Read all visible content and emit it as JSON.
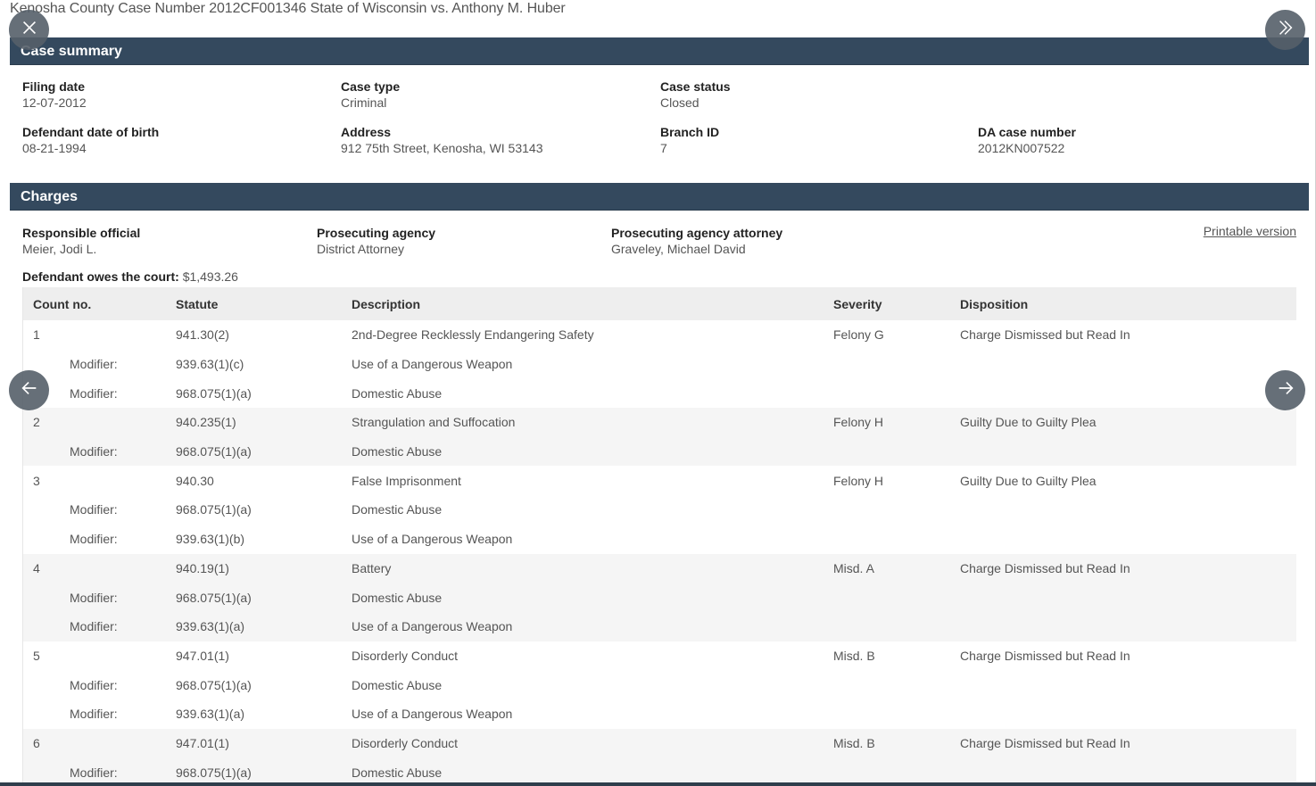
{
  "page": {
    "title": "Kenosha County Case Number 2012CF001346 State of Wisconsin vs. Anthony M. Huber"
  },
  "summary": {
    "heading": "Case summary",
    "fields": [
      {
        "label": "Filing date",
        "value": "12-07-2012"
      },
      {
        "label": "Case type",
        "value": "Criminal"
      },
      {
        "label": "Case status",
        "value": "Closed"
      },
      {
        "label": "Defendant date of birth",
        "value": "08-21-1994"
      },
      {
        "label": "Address",
        "value": "912 75th Street, Kenosha, WI 53143"
      },
      {
        "label": "Branch ID",
        "value": "7"
      },
      {
        "label": "DA case number",
        "value": "2012KN007522"
      }
    ]
  },
  "charges": {
    "heading": "Charges",
    "fields": [
      {
        "label": "Responsible official",
        "value": "Meier, Jodi L."
      },
      {
        "label": "Prosecuting agency",
        "value": "District Attorney"
      },
      {
        "label": "Prosecuting agency attorney",
        "value": "Graveley, Michael David"
      }
    ],
    "printable_label": "Printable version",
    "owes_label": "Defendant owes the court:",
    "owes_value": "$1,493.26",
    "columns": [
      "Count no.",
      "Statute",
      "Description",
      "Severity",
      "Disposition"
    ],
    "rows": [
      {
        "count": "1",
        "modifier": "",
        "statute": "941.30(2)",
        "description": "2nd-Degree Recklessly Endangering Safety",
        "severity": "Felony G",
        "disposition": "Charge Dismissed but Read In",
        "group": "odd"
      },
      {
        "count": "",
        "modifier": "Modifier:",
        "statute": "939.63(1)(c)",
        "description": "Use of a Dangerous Weapon",
        "severity": "",
        "disposition": "",
        "group": "odd"
      },
      {
        "count": "",
        "modifier": "Modifier:",
        "statute": "968.075(1)(a)",
        "description": "Domestic Abuse",
        "severity": "",
        "disposition": "",
        "group": "odd"
      },
      {
        "count": "2",
        "modifier": "",
        "statute": "940.235(1)",
        "description": "Strangulation and Suffocation",
        "severity": "Felony H",
        "disposition": "Guilty Due to Guilty Plea",
        "group": "even"
      },
      {
        "count": "",
        "modifier": "Modifier:",
        "statute": "968.075(1)(a)",
        "description": "Domestic Abuse",
        "severity": "",
        "disposition": "",
        "group": "even"
      },
      {
        "count": "3",
        "modifier": "",
        "statute": "940.30",
        "description": "False Imprisonment",
        "severity": "Felony H",
        "disposition": "Guilty Due to Guilty Plea",
        "group": "odd"
      },
      {
        "count": "",
        "modifier": "Modifier:",
        "statute": "968.075(1)(a)",
        "description": "Domestic Abuse",
        "severity": "",
        "disposition": "",
        "group": "odd"
      },
      {
        "count": "",
        "modifier": "Modifier:",
        "statute": "939.63(1)(b)",
        "description": "Use of a Dangerous Weapon",
        "severity": "",
        "disposition": "",
        "group": "odd"
      },
      {
        "count": "4",
        "modifier": "",
        "statute": "940.19(1)",
        "description": "Battery",
        "severity": "Misd. A",
        "disposition": "Charge Dismissed but Read In",
        "group": "even"
      },
      {
        "count": "",
        "modifier": "Modifier:",
        "statute": "968.075(1)(a)",
        "description": "Domestic Abuse",
        "severity": "",
        "disposition": "",
        "group": "even"
      },
      {
        "count": "",
        "modifier": "Modifier:",
        "statute": "939.63(1)(a)",
        "description": "Use of a Dangerous Weapon",
        "severity": "",
        "disposition": "",
        "group": "even"
      },
      {
        "count": "5",
        "modifier": "",
        "statute": "947.01(1)",
        "description": "Disorderly Conduct",
        "severity": "Misd. B",
        "disposition": "Charge Dismissed but Read In",
        "group": "odd"
      },
      {
        "count": "",
        "modifier": "Modifier:",
        "statute": "968.075(1)(a)",
        "description": "Domestic Abuse",
        "severity": "",
        "disposition": "",
        "group": "odd"
      },
      {
        "count": "",
        "modifier": "Modifier:",
        "statute": "939.63(1)(a)",
        "description": "Use of a Dangerous Weapon",
        "severity": "",
        "disposition": "",
        "group": "odd"
      },
      {
        "count": "6",
        "modifier": "",
        "statute": "947.01(1)",
        "description": "Disorderly Conduct",
        "severity": "Misd. B",
        "disposition": "Charge Dismissed but Read In",
        "group": "even"
      },
      {
        "count": "",
        "modifier": "Modifier:",
        "statute": "968.075(1)(a)",
        "description": "Domestic Abuse",
        "severity": "",
        "disposition": "",
        "group": "even"
      }
    ]
  },
  "viewer": {
    "close_icon": "close-icon",
    "expand_icon": "double-chevron-right-icon",
    "prev_icon": "arrow-left-icon",
    "next_icon": "arrow-right-icon"
  },
  "colors": {
    "section_bar": "#34495e",
    "nav_button": "#555f69"
  }
}
